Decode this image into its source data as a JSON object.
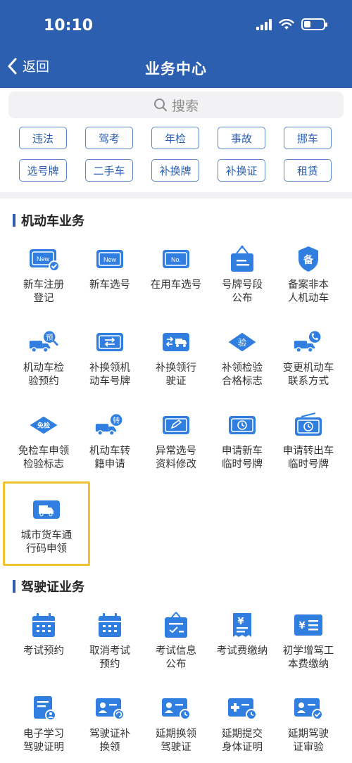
{
  "status": {
    "time": "10:10"
  },
  "nav": {
    "back_label": "返回",
    "title": "业务中心"
  },
  "search": {
    "placeholder": "搜索"
  },
  "tags": [
    "违法",
    "驾考",
    "年检",
    "事故",
    "挪车",
    "选号牌",
    "二手车",
    "补换牌",
    "补换证",
    "租赁"
  ],
  "sections": [
    {
      "title": "机动车业务"
    },
    {
      "title": "驾驶证业务"
    }
  ],
  "vehicle_items": [
    {
      "label": "新车注册\n登记",
      "icon": "new-plate-check-icon",
      "badge": "New"
    },
    {
      "label": "新车选号",
      "icon": "new-plate-icon",
      "badge": "New"
    },
    {
      "label": "在用车选号",
      "icon": "plate-no-icon",
      "badge": "No."
    },
    {
      "label": "号牌号段\n公布",
      "icon": "plate-hanging-icon",
      "badge": ""
    },
    {
      "label": "备案非本\n人机动车",
      "icon": "shield-record-icon",
      "badge": "备"
    },
    {
      "label": "机动车检\n验预约",
      "icon": "truck-appointment-icon",
      "badge": "预"
    },
    {
      "label": "补换领机\n动车号牌",
      "icon": "plate-exchange-icon",
      "badge": ""
    },
    {
      "label": "补换领行\n驶证",
      "icon": "license-exchange-truck-icon",
      "badge": ""
    },
    {
      "label": "补领检验\n合格标志",
      "icon": "inspection-diamond-icon",
      "badge": "验"
    },
    {
      "label": "变更机动车\n联系方式",
      "icon": "truck-phone-icon",
      "badge": ""
    },
    {
      "label": "免检车申领\n检验标志",
      "icon": "exempt-diamond-icon",
      "badge": "免检"
    },
    {
      "label": "机动车转\n籍申请",
      "icon": "truck-transfer-icon",
      "badge": "转"
    },
    {
      "label": "异常选号\n资料修改",
      "icon": "plate-edit-icon",
      "badge": ""
    },
    {
      "label": "申请新车\n临时号牌",
      "icon": "temp-plate-clock-icon",
      "badge": ""
    },
    {
      "label": "申请转出车\n临时号牌",
      "icon": "temp-plate-radio-icon",
      "badge": ""
    },
    {
      "label": "城市货车通\n行码申领",
      "icon": "truck-pass-icon",
      "badge": ""
    }
  ],
  "license_items": [
    {
      "label": "考试预约",
      "icon": "calendar-icon",
      "badge": ""
    },
    {
      "label": "取消考试\n预约",
      "icon": "calendar-cancel-icon",
      "badge": ""
    },
    {
      "label": "考试信息\n公布",
      "icon": "exam-info-icon",
      "badge": ""
    },
    {
      "label": "考试费缴纳",
      "icon": "fee-receipt-icon",
      "badge": "¥"
    },
    {
      "label": "初学增驾工\n本费缴纳",
      "icon": "fee-card-icon",
      "badge": "¥"
    },
    {
      "label": "电子学习\n驾驶证明",
      "icon": "e-learning-doc-icon",
      "badge": ""
    },
    {
      "label": "驾驶证补\n换领",
      "icon": "license-renew-icon",
      "badge": ""
    },
    {
      "label": "延期换领\n驾驶证",
      "icon": "license-extend-icon",
      "badge": ""
    },
    {
      "label": "延期提交\n身体证明",
      "icon": "health-extend-icon",
      "badge": ""
    },
    {
      "label": "延期驾驶\n证审验",
      "icon": "license-review-icon",
      "badge": ""
    }
  ],
  "colors": {
    "primary": "#2d5fb0",
    "icon_blue": "#2f7ee0",
    "highlight": "#f2c12e"
  }
}
